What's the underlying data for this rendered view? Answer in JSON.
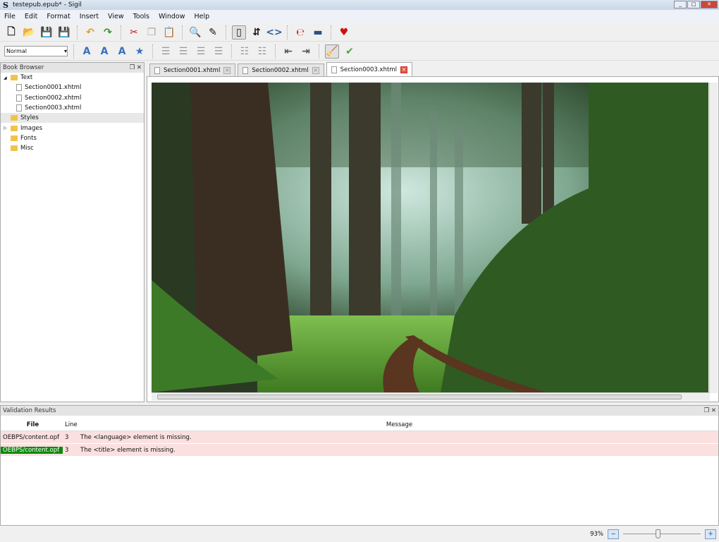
{
  "window": {
    "title": "testepub.epub* - Sigil",
    "logo": "S"
  },
  "menu": [
    "File",
    "Edit",
    "Format",
    "Insert",
    "View",
    "Tools",
    "Window",
    "Help"
  ],
  "toolbar1": [
    {
      "name": "new-icon",
      "glyph": "🗋"
    },
    {
      "name": "open-icon",
      "glyph": "📂"
    },
    {
      "name": "save-icon",
      "glyph": "💾"
    },
    {
      "name": "save-as-icon",
      "glyph": "💾"
    },
    {
      "sep": true
    },
    {
      "name": "undo-icon",
      "glyph": "↶",
      "color": "#e0a020"
    },
    {
      "name": "redo-icon",
      "glyph": "↷",
      "color": "#2a9a2a"
    },
    {
      "sep": true
    },
    {
      "name": "cut-icon",
      "glyph": "✂",
      "color": "#c02020"
    },
    {
      "name": "copy-icon",
      "glyph": "❐",
      "color": "#aaa"
    },
    {
      "name": "paste-icon",
      "glyph": "📋"
    },
    {
      "sep": true
    },
    {
      "name": "find-icon",
      "glyph": "🔍"
    },
    {
      "name": "meta-editor-icon",
      "glyph": "✎"
    },
    {
      "sep": true
    },
    {
      "name": "book-view-icon",
      "glyph": "▯",
      "active": true
    },
    {
      "name": "split-view-icon",
      "glyph": "⇵"
    },
    {
      "name": "code-view-icon",
      "glyph": "<>",
      "color": "#3060a0"
    },
    {
      "sep": true
    },
    {
      "name": "spellcheck-icon",
      "glyph": "℮",
      "color": "#c02020"
    },
    {
      "name": "toc-icon",
      "glyph": "▬",
      "color": "#305080"
    },
    {
      "sep": true
    },
    {
      "name": "donate-heart-icon",
      "glyph": "♥",
      "color": "#d01010"
    }
  ],
  "toolbar2": {
    "style_select": "Normal",
    "buttons": [
      {
        "name": "bold-icon",
        "glyph": "A",
        "color": "#3a70c0"
      },
      {
        "name": "italic-icon",
        "glyph": "A",
        "color": "#3a70c0"
      },
      {
        "name": "underline-icon",
        "glyph": "A",
        "color": "#3a70c0"
      },
      {
        "name": "strike-icon",
        "glyph": "★",
        "color": "#3a70c0"
      },
      {
        "sep": true
      },
      {
        "name": "align-left-icon",
        "glyph": "☰",
        "color": "#999"
      },
      {
        "name": "align-center-icon",
        "glyph": "☰",
        "color": "#999"
      },
      {
        "name": "align-right-icon",
        "glyph": "☰",
        "color": "#999"
      },
      {
        "name": "justify-icon",
        "glyph": "☰",
        "color": "#999"
      },
      {
        "sep": true
      },
      {
        "name": "numbered-list-icon",
        "glyph": "☷",
        "color": "#999"
      },
      {
        "name": "bullet-list-icon",
        "glyph": "☷",
        "color": "#999"
      },
      {
        "sep": true
      },
      {
        "name": "decrease-indent-icon",
        "glyph": "⇤",
        "color": "#555"
      },
      {
        "name": "increase-indent-icon",
        "glyph": "⇥",
        "color": "#555"
      },
      {
        "sep": true
      },
      {
        "name": "tidy-broom-icon",
        "glyph": "🧹",
        "active": true
      },
      {
        "name": "validate-check-icon",
        "glyph": "✔",
        "color": "#3ab03a"
      }
    ]
  },
  "book_browser": {
    "title": "Book Browser",
    "items": [
      {
        "label": "Text",
        "type": "folder",
        "level": 0,
        "expand": "◢"
      },
      {
        "label": "Section0001.xhtml",
        "type": "file",
        "level": 1
      },
      {
        "label": "Section0002.xhtml",
        "type": "file",
        "level": 1
      },
      {
        "label": "Section0003.xhtml",
        "type": "file",
        "level": 1
      },
      {
        "label": "Styles",
        "type": "folder",
        "level": 0,
        "selected": true
      },
      {
        "label": "Images",
        "type": "folder",
        "level": 0,
        "expand": "▷"
      },
      {
        "label": "Fonts",
        "type": "folder",
        "level": 0
      },
      {
        "label": "Misc",
        "type": "folder",
        "level": 0
      }
    ]
  },
  "tabs": [
    {
      "label": "Section0001.xhtml"
    },
    {
      "label": "Section0002.xhtml"
    },
    {
      "label": "Section0003.xhtml",
      "active": true
    }
  ],
  "validation": {
    "title": "Validation Results",
    "columns": [
      "File",
      "Line",
      "Message"
    ],
    "rows": [
      {
        "file": "OEBPS/content.opf",
        "line": "3",
        "message": "The <language> element is missing."
      },
      {
        "file": "OEBPS/content.opf",
        "line": "3",
        "message": "The <title> element is missing.",
        "selected": true
      }
    ]
  },
  "status": {
    "zoom": "93%",
    "zoom_fraction": 0.45
  },
  "colors": {
    "selected_cell": "#0a8a0a",
    "error_row": "#fbe0e0"
  }
}
